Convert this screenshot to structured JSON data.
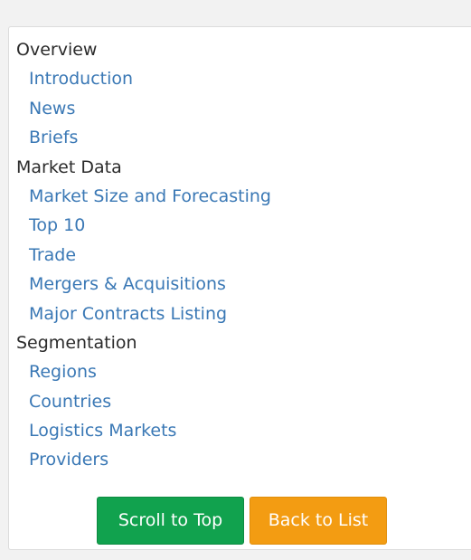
{
  "toc": [
    {
      "type": "heading",
      "text": "Overview"
    },
    {
      "type": "link",
      "text": "Introduction"
    },
    {
      "type": "link",
      "text": "News"
    },
    {
      "type": "link",
      "text": "Briefs"
    },
    {
      "type": "heading",
      "text": "Market Data"
    },
    {
      "type": "link",
      "text": "Market Size and Forecasting"
    },
    {
      "type": "link",
      "text": "Top 10"
    },
    {
      "type": "link",
      "text": "Trade"
    },
    {
      "type": "link",
      "text": "Mergers & Acquisitions"
    },
    {
      "type": "link",
      "text": "Major Contracts Listing"
    },
    {
      "type": "heading",
      "text": "Segmentation"
    },
    {
      "type": "link",
      "text": "Regions"
    },
    {
      "type": "link",
      "text": "Countries"
    },
    {
      "type": "link",
      "text": "Logistics Markets"
    },
    {
      "type": "link",
      "text": "Providers"
    }
  ],
  "buttons": {
    "scroll_to_top": "Scroll to Top",
    "back_to_list": "Back to List"
  },
  "colors": {
    "link": "#3a78b5",
    "heading": "#2b2b2b",
    "scroll_button": "#11a24e",
    "back_button": "#f39c12"
  }
}
